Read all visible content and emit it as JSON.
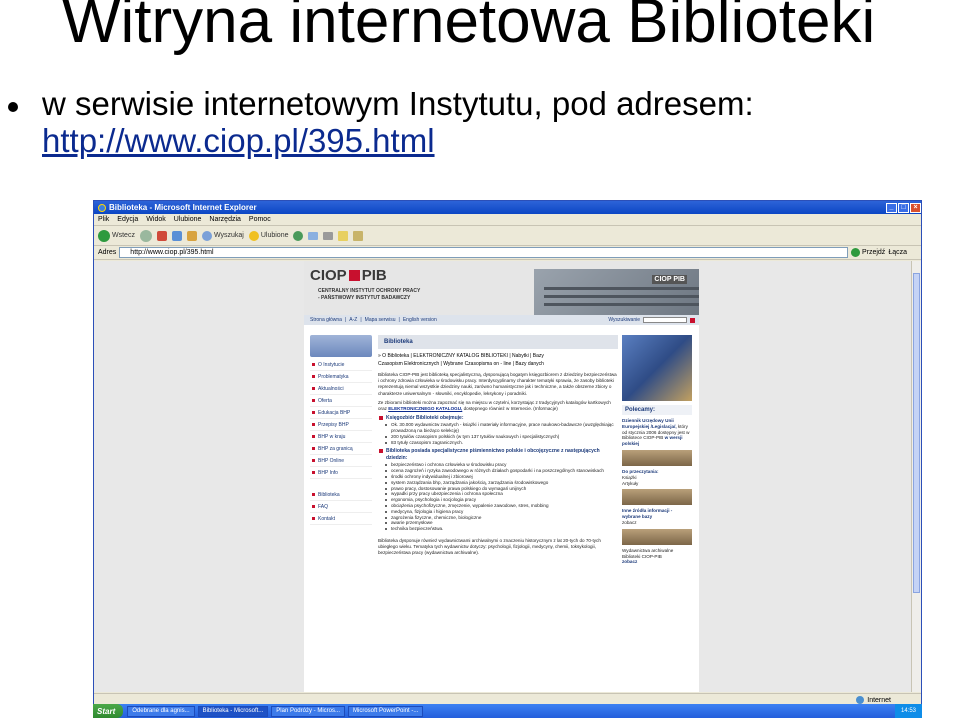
{
  "slide": {
    "title": "Witryna internetowa Biblioteki",
    "bullet_line1": "w serwisie internetowym Instytutu, pod adresem:",
    "bullet_url": "http://www.ciop.pl/395.html"
  },
  "browser": {
    "window_title": "Biblioteka - Microsoft Internet Explorer",
    "menu": [
      "Plik",
      "Edycja",
      "Widok",
      "Ulubione",
      "Narzędzia",
      "Pomoc"
    ],
    "toolbar": {
      "back": "Wstecz",
      "search": "Wyszukaj",
      "favorites": "Ulubione"
    },
    "address_label": "Adres",
    "address_value": "http://www.ciop.pl/395.html",
    "go_label": "Przejdź",
    "links_label": "Łącza",
    "status_zone": "Internet"
  },
  "site": {
    "logo_left": "CIOP",
    "logo_right": "PIB",
    "tagline1": "CENTRALNY INSTYTUT OCHRONY PRACY",
    "tagline2": "- PAŃSTWOWY INSTYTUT BADAWCZY",
    "building_sign": "CIOP PIB",
    "nav": {
      "home": "Strona główna",
      "az": "A-Z",
      "map": "Mapa serwisu",
      "english": "English version",
      "search_label": "Wyszukiwanie"
    },
    "leftnav": [
      "O Instytucie",
      "Problematyka",
      "Aktualności",
      "Oferta",
      "Edukacja BHP",
      "Przepisy BHP",
      "BHP w kraju",
      "BHP za granicą",
      "BHP Online",
      "BHP Info"
    ],
    "leftnav2": [
      "Biblioteka",
      "FAQ",
      "Kontakt"
    ],
    "content": {
      "heading": "Biblioteka",
      "tabs_line1": "» O Biblioteka | ELEKTRONICZNY KATALOG BIBLIOTEKI | Nabytki | Bazy",
      "tabs_line2": "Czasopism Elektronicznych | Wybrane Czasopisma on - line | Bazy danych",
      "para1": "Biblioteka CIOP-PIB jest biblioteką specjalistyczną, dysponującą bogatym księgozbiorem z dziedziny bezpieczeństwa i ochrony zdrowia człowieka w środowisku pracy. Interdyscyplinarny charakter tematyki sprawia, że zasoby biblioteki reprezentują niemal wszystkie dziedziny nauki, zarówno humanistyczne jak i techniczne, a także obszerne zbiory o charakterze uniwersalnym - słowniki, encyklopedie, leksykony i poradniki.",
      "para2_pre": "Ze zbiorami biblioteki można zapoznać się na miejscu w czytelni, korzystając z tradycyjnych katalogów kartkowych oraz",
      "para2_link": "ELEKTRONICZNEGO KATALOGU,",
      "para2_post": "dostępnego również w Internecie. (Informacje)",
      "section1_title": "Księgozbiór Biblioteki obejmuje:",
      "section1_items": [
        "Ok. 30.000 wydawnictw zwartych - książki i materiały informacyjne, prace naukowo-badawcze (uwzględniając prowadzoną na bieżąco selekcję)",
        "200 tytułów czasopism polskich (w tym 137 tytułów naukowych i specjalistycznych)",
        "83 tytuły czasopism zagranicznych."
      ],
      "section2_title": "Biblioteka posiada specjalistyczne piśmiennictwo polskie i obcojęzyczne z następujących dziedzin:",
      "section2_items": [
        "bezpieczeństwo i ochrona człowieka w środowisku pracy",
        "ocena zagrożeń i ryzyka zawodowego w różnych działach gospodarki i na poszczególnych stanowiskach",
        "środki ochrony indywidualnej i zbiorowej",
        "system zarządzania bhp, zarządzania jakością, zarządzania środowiskowego",
        "prawo pracy, dostosowanie prawa polskiego do wymagań unijnych",
        "wypadki przy pracy ubezpieczenia i ochrona społeczna",
        "ergonomia, psychologia i socjologia pracy",
        "obciążenia psychofizyczne, zmęczenie, wypalenie zawodowe, stres, mobbing",
        "medycyna, fizjologia i higiena pracy",
        "zagrożenia fizyczne, chemiczne, biologiczne",
        "awarie przemysłowe",
        "technika bezpieczeństwa."
      ],
      "para3": "Biblioteka dysponuje również wydawnictwami archiwalnymi o znaczeniu historycznym z lat 20-tych do 70-tych ubiegłego wieku. Tematyka tych wydawnictw dotyczy: psychologii, fizjologii, medycyny, chemii, toksykologii, bezpieczeństwa pracy (wydawnictwa archiwalne)."
    },
    "right": {
      "polecamy": "Polecamy:",
      "dz_title": "Dziennik Urzędowy Unii Europejskiej /Legislacja/,",
      "dz_text": "który od stycznia 2006 dostępny jest w Bibliotece CIOP-PIB",
      "dz_link": "w wersji polskiej",
      "do_title": "Do przeczytania:",
      "do_items": [
        "Książki",
        "Artykuły"
      ],
      "inne_title": "Inne źródła informacji - wybrane bazy",
      "inne_item": "zobacz",
      "arch_text": "Wydawnictwa archiwalne Biblioteki CIOP-PIB",
      "arch_link": "zobacz"
    }
  },
  "taskbar": {
    "start": "Start",
    "tasks": [
      "Odebrane dla agnis...",
      "Biblioteka - Microsoft...",
      "Plan Podróży - Micros...",
      "Microsoft PowerPoint -..."
    ],
    "clock": "14:53"
  }
}
